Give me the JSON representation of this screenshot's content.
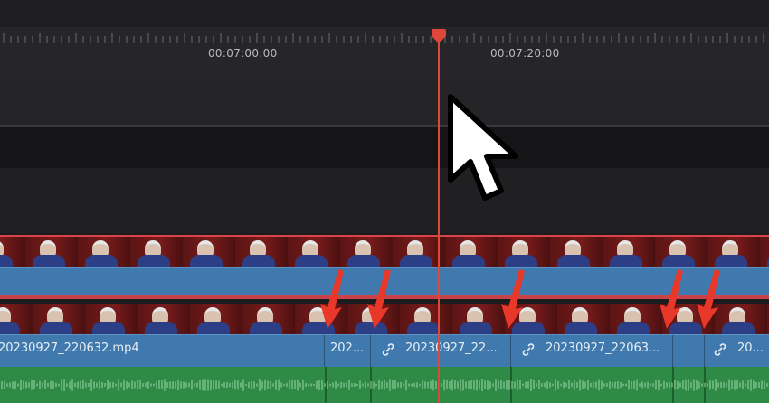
{
  "ruler": {
    "timecodes": [
      "00:07:00:00",
      "00:07:20:00"
    ]
  },
  "tracks": {
    "video_top": {
      "clip_selected": true
    },
    "video_main": {
      "clips": [
        {
          "label": "20230927_220632.mp4",
          "linked": false
        },
        {
          "label": "202...",
          "linked": false
        },
        {
          "label": "20230927_22...",
          "linked": true
        },
        {
          "label": "20230927_22063...",
          "linked": true
        },
        {
          "label": "",
          "linked": false
        },
        {
          "label": "20...",
          "linked": true
        }
      ]
    },
    "audio": {
      "type": "waveform"
    }
  },
  "annotations": {
    "arrow_color": "#e8382a",
    "arrow_count": 5
  },
  "playhead": {
    "color": "#d94a3a"
  },
  "icons": {
    "link": "link-icon",
    "cursor": "mouse-pointer-icon",
    "playhead": "playhead-marker-icon"
  }
}
